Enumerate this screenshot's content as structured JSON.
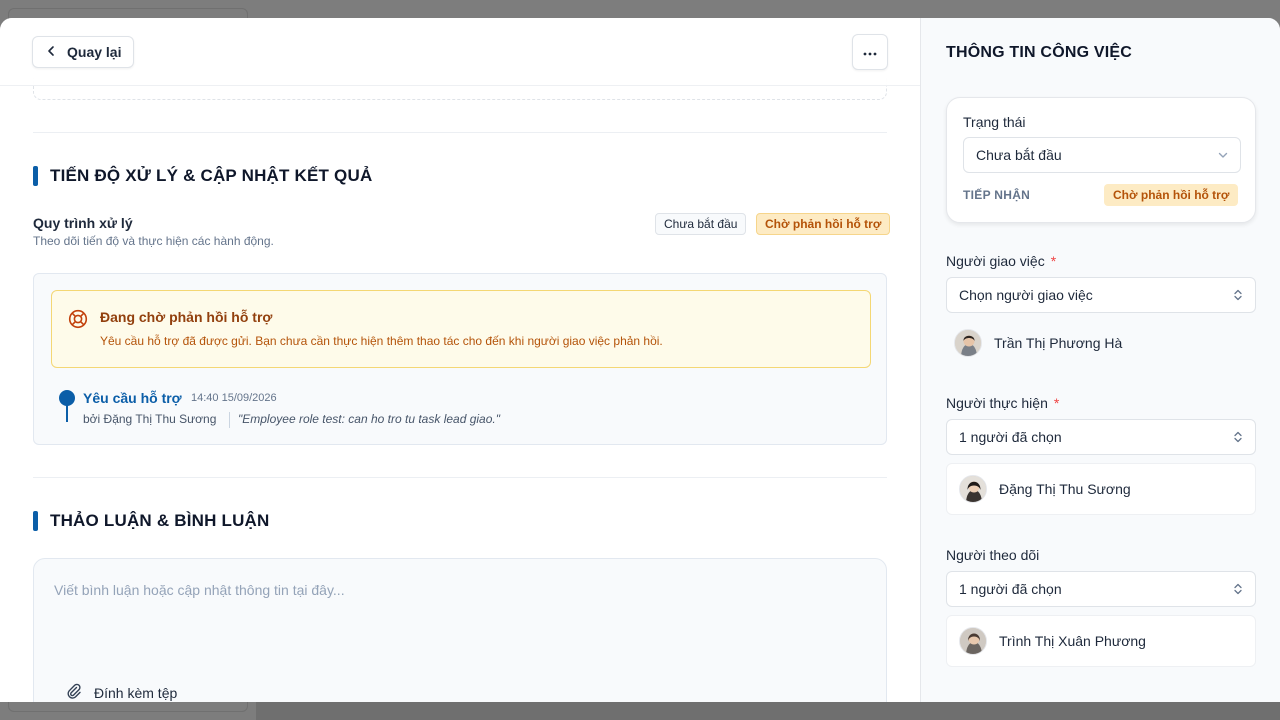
{
  "topbar": {
    "back_label": "Quay lại",
    "back_icon": "chevron-left-icon",
    "more_icon": "more-horizontal-icon"
  },
  "progress_section": {
    "title": "TIẾN ĐỘ XỬ LÝ & CẬP NHẬT KẾT QUẢ",
    "process_title": "Quy trình xử lý",
    "process_subtitle": "Theo dõi tiến độ và thực hiện các hành động.",
    "status_tag": "Chưa bắt đầu",
    "waiting_tag": "Chờ phản hồi hỗ trợ",
    "alert": {
      "icon": "life-buoy-icon",
      "title": "Đang chờ phản hồi hỗ trợ",
      "text": "Yêu cầu hỗ trợ đã được gửi. Bạn chưa cần thực hiện thêm thao tác cho đến khi người giao việc phản hồi."
    },
    "timeline": [
      {
        "title": "Yêu cầu hỗ trợ",
        "time": "14:40 15/09/2026",
        "by": "bởi Đặng Thị Thu Sương",
        "quote": "\"Employee role test: can ho tro tu task lead giao.\""
      }
    ]
  },
  "discussion_section": {
    "title": "THẢO LUẬN & BÌNH LUẬN",
    "comment_placeholder": "Viết bình luận hoặc cập nhật thông tin tại đây...",
    "attach_label": "Đính kèm tệp",
    "attach_icon": "paperclip-icon"
  },
  "sidebar": {
    "title": "THÔNG TIN CÔNG VIỆC",
    "status": {
      "label": "Trạng thái",
      "value": "Chưa bắt đầu",
      "stage_label": "TIẾP NHẬN",
      "stage_badge": "Chờ phản hồi hỗ trợ"
    },
    "assigner": {
      "label": "Người giao việc",
      "required_mark": "*",
      "select_value": "Chọn người giao việc",
      "person": "Trần Thị Phương Hà"
    },
    "executor": {
      "label": "Người thực hiện",
      "required_mark": "*",
      "select_value": "1 người đã chọn",
      "person": "Đặng Thị Thu Sương"
    },
    "watchers": {
      "label": "Người theo dõi",
      "select_value": "1 người đã chọn",
      "person": "Trình Thị Xuân Phương"
    }
  },
  "colors": {
    "accent": "#0b5ea8",
    "warning_bg": "#fefbea",
    "warning_text": "#b45309",
    "required": "#ef4444"
  }
}
